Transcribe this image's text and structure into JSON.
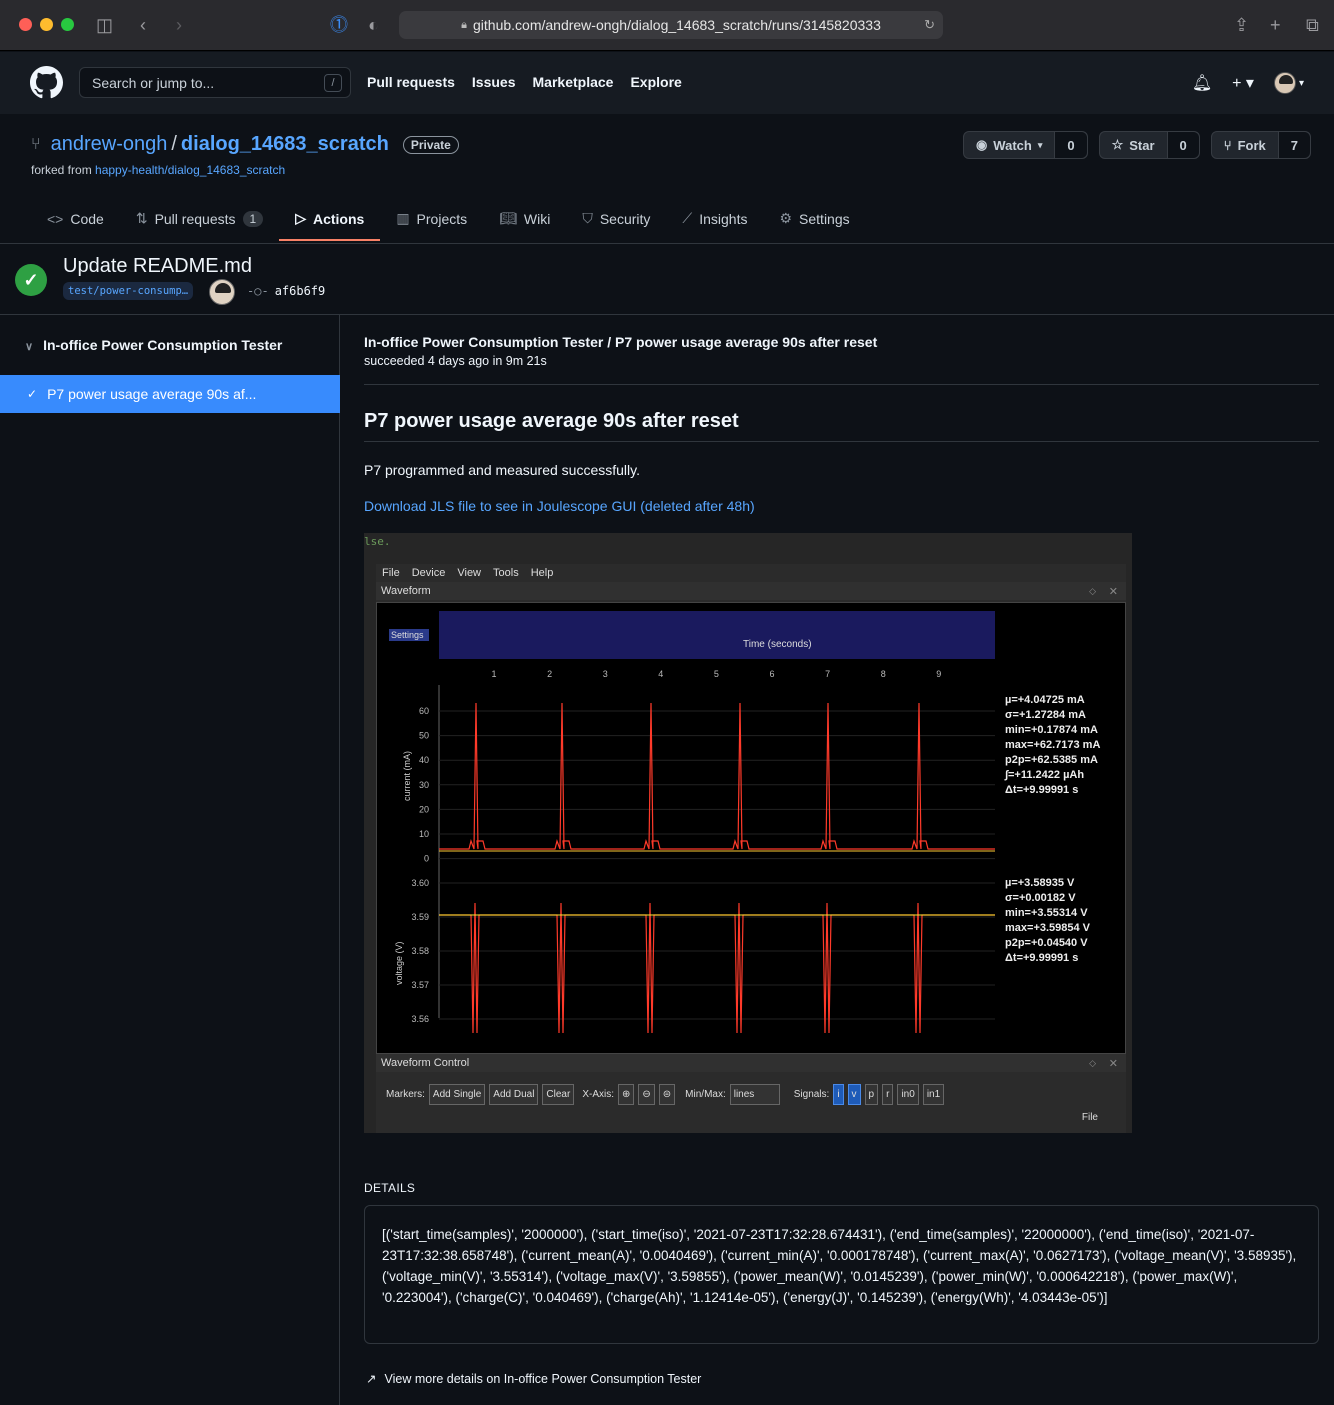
{
  "browser": {
    "url": "github.com/andrew-ongh/dialog_14683_scratch/runs/3145820333"
  },
  "header": {
    "search_placeholder": "Search or jump to...",
    "search_key": "/",
    "nav": [
      "Pull requests",
      "Issues",
      "Marketplace",
      "Explore"
    ]
  },
  "repo": {
    "owner": "andrew-ongh",
    "name": "dialog_14683_scratch",
    "visibility": "Private",
    "forked_prefix": "forked from",
    "forked_from": "happy-health/dialog_14683_scratch",
    "watch_label": "Watch",
    "watch_count": "0",
    "star_label": "Star",
    "star_count": "0",
    "fork_label": "Fork",
    "fork_count": "7"
  },
  "tabs": [
    {
      "label": "Code",
      "icon": "code-icon"
    },
    {
      "label": "Pull requests",
      "icon": "pull-request-icon",
      "counter": "1"
    },
    {
      "label": "Actions",
      "icon": "play-icon",
      "active": true
    },
    {
      "label": "Projects",
      "icon": "project-icon"
    },
    {
      "label": "Wiki",
      "icon": "book-icon"
    },
    {
      "label": "Security",
      "icon": "shield-icon"
    },
    {
      "label": "Insights",
      "icon": "graph-icon"
    },
    {
      "label": "Settings",
      "icon": "gear-icon"
    }
  ],
  "run": {
    "title": "Update README.md",
    "branch": "test/power-consump…",
    "commit": "af6b6f9"
  },
  "sidebar": {
    "group": "In-office Power Consumption Tester",
    "item": "P7 power usage average 90s af..."
  },
  "main": {
    "job_title": "In-office Power Consumption Tester / P7 power usage average 90s after reset",
    "job_status": "succeeded 4 days ago in 9m 21s",
    "heading": "P7 power usage average 90s after reset",
    "paragraph": "P7 programmed and measured successfully.",
    "download_link": "Download JLS file to see in Joulescope GUI (deleted after 48h)",
    "details_heading": "DETAILS",
    "details_text": "[('start_time(samples)', '2000000'), ('start_time(iso)', '2021-07-23T17:32:28.674431'), ('end_time(samples)', '22000000'), ('end_time(iso)', '2021-07-23T17:32:38.658748'), ('current_mean(A)', '0.0040469'), ('current_min(A)', '0.000178748'), ('current_max(A)', '0.0627173'), ('voltage_mean(V)', '3.58935'), ('voltage_min(V)', '3.55314'), ('voltage_max(V)', '3.59855'), ('power_mean(W)', '0.0145239'), ('power_min(W)', '0.000642218'), ('power_max(W)', '0.223004'), ('charge(C)', '0.040469'), ('charge(Ah)', '1.12414e-05'), ('energy(J)', '0.145239'), ('energy(Wh)', '4.03443e-05')]",
    "more_link": "View more details on In-office Power Consumption Tester"
  },
  "joulescope": {
    "menu": [
      "File",
      "Device",
      "View",
      "Tools",
      "Help"
    ],
    "waveform_title": "Waveform",
    "settings_label": "Settings",
    "time_label": "Time (seconds)",
    "x_ticks": [
      "1",
      "2",
      "3",
      "4",
      "5",
      "6",
      "7",
      "8",
      "9"
    ],
    "current_axis_label": "current (mA)",
    "current_ticks": [
      "60",
      "50",
      "40",
      "30",
      "20",
      "10",
      "0"
    ],
    "voltage_axis_label": "voltage (V)",
    "voltage_ticks": [
      "3.60",
      "3.59",
      "3.58",
      "3.57",
      "3.56"
    ],
    "current_stats": [
      "µ=+4.04725 mA",
      "σ=+1.27284 mA",
      "min=+0.17874 mA",
      "max=+62.7173 mA",
      "p2p=+62.5385 mA",
      "∫=+11.2422 µAh",
      "Δt=+9.99991  s"
    ],
    "voltage_stats": [
      "µ=+3.58935  V",
      "σ=+0.00182  V",
      "min=+3.55314  V",
      "max=+3.59854  V",
      "p2p=+0.04540  V",
      "Δt=+9.99991  s"
    ],
    "control_title": "Waveform Control",
    "markers_label": "Markers:",
    "add_single": "Add Single",
    "add_dual": "Add Dual",
    "clear": "Clear",
    "xaxis_label": "X-Axis:",
    "minmax_label": "Min/Max:",
    "minmax_value": "lines",
    "signals_label": "Signals:",
    "signals": [
      "i",
      "v",
      "p",
      "r",
      "in0",
      "in1"
    ],
    "file_label": "File",
    "bg_text": "lse."
  }
}
